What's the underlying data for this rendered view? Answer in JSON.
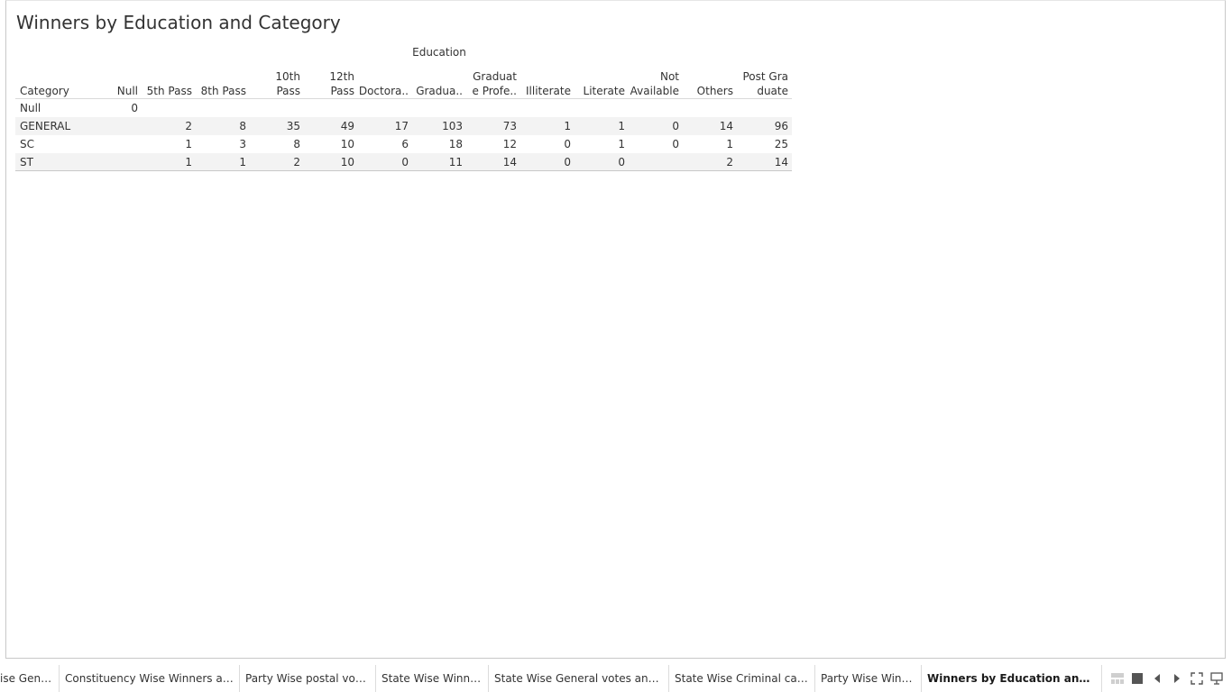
{
  "sheet": {
    "title": "Winners by Education and Category",
    "column_group_label": "Education"
  },
  "table": {
    "row_header": "Category",
    "columns": [
      "Null",
      "5th Pass",
      "8th Pass",
      "10th\nPass",
      "12th\nPass",
      "Doctora..",
      "Gradua..",
      "Graduat\ne Profe..",
      "Illiterate",
      "Literate",
      "Not\nAvailable",
      "Others",
      "Post Gra\nduate"
    ],
    "rows": [
      {
        "category": "Null",
        "values": [
          "0",
          "",
          "",
          "",
          "",
          "",
          "",
          "",
          "",
          "",
          "",
          "",
          ""
        ]
      },
      {
        "category": "GENERAL",
        "values": [
          "",
          "2",
          "8",
          "35",
          "49",
          "17",
          "103",
          "73",
          "1",
          "1",
          "0",
          "14",
          "96"
        ]
      },
      {
        "category": "SC",
        "values": [
          "",
          "1",
          "3",
          "8",
          "10",
          "6",
          "18",
          "12",
          "0",
          "1",
          "0",
          "1",
          "25"
        ]
      },
      {
        "category": "ST",
        "values": [
          "",
          "1",
          "1",
          "2",
          "10",
          "0",
          "11",
          "14",
          "0",
          "0",
          "",
          "2",
          "14"
        ]
      }
    ]
  },
  "tabs": [
    {
      "label": "ise Gene..."
    },
    {
      "label": "Constituency Wise Winners and ..."
    },
    {
      "label": "Party Wise postal votes"
    },
    {
      "label": "State Wise Winners"
    },
    {
      "label": "State Wise General votes  and P..."
    },
    {
      "label": "State Wise Criminal cases"
    },
    {
      "label": "Party Wise Winner"
    },
    {
      "label": "Winners by Education and Cat..."
    }
  ],
  "active_tab_index": 7,
  "controls": {
    "icons": [
      "grid-view-icon",
      "filmstrip-view-icon",
      "prev-sheet-icon",
      "next-sheet-icon",
      "fullscreen-icon",
      "present-icon"
    ]
  }
}
